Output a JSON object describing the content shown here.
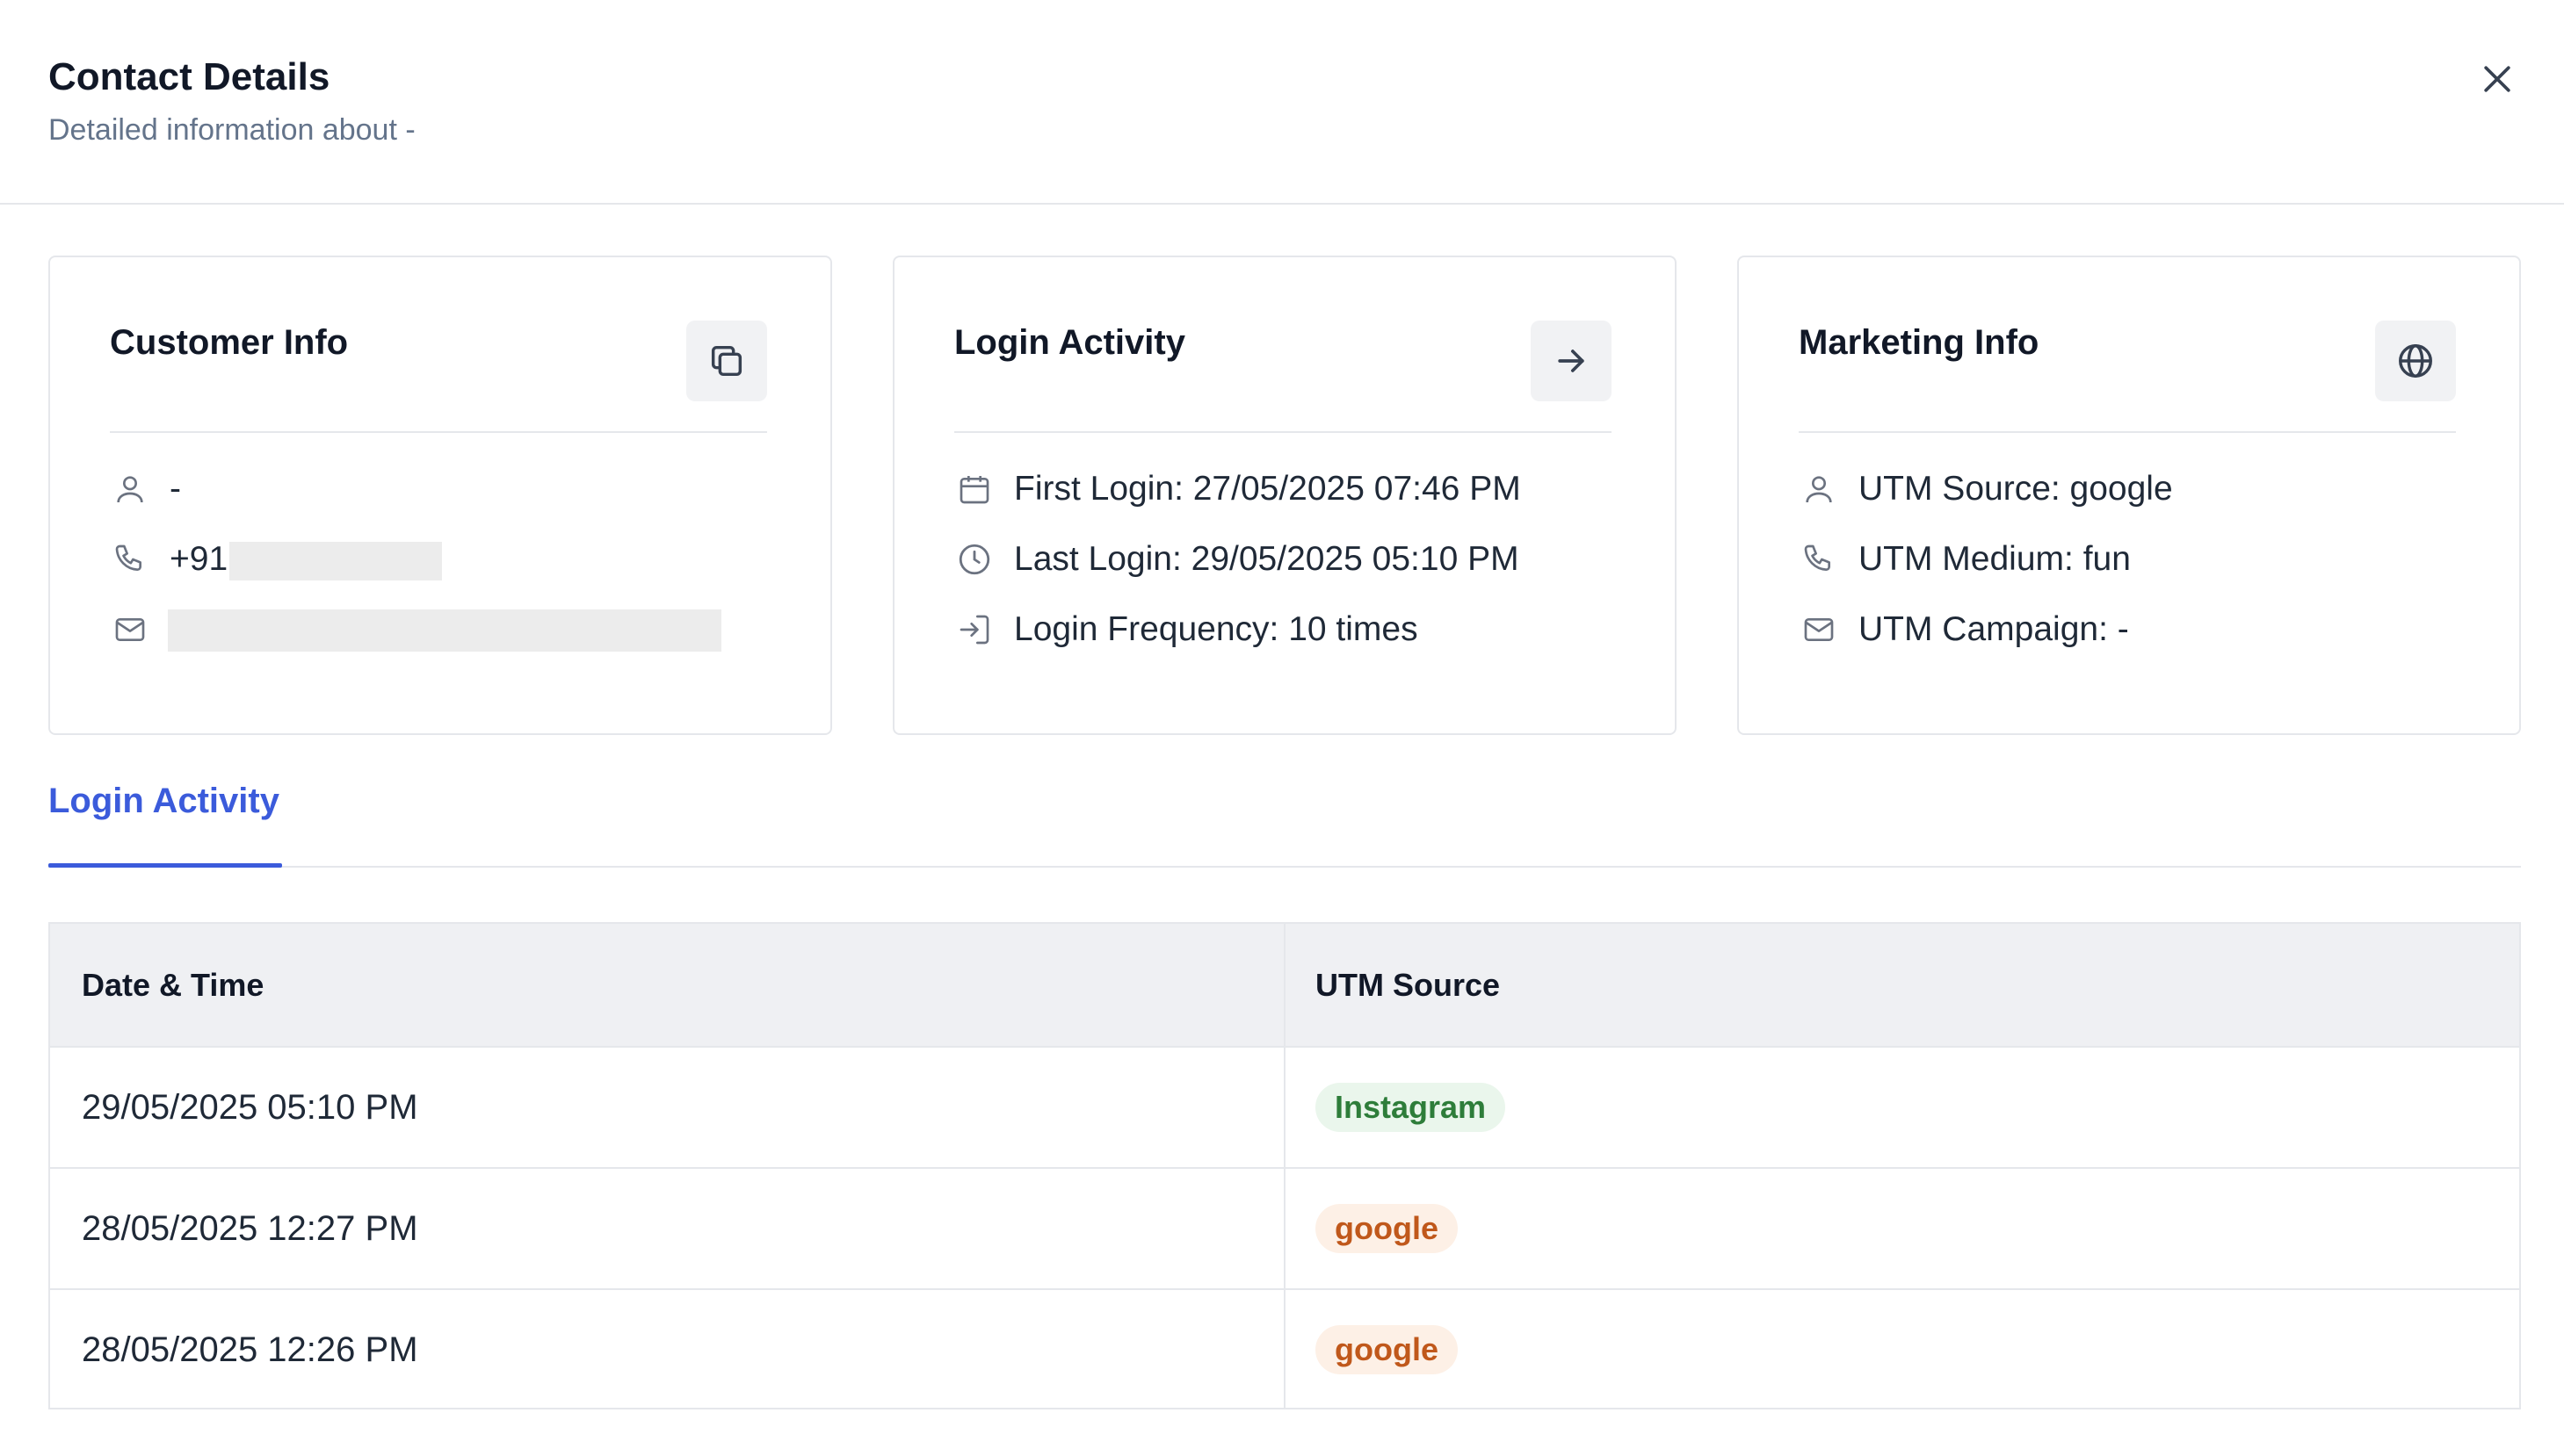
{
  "header": {
    "title": "Contact Details",
    "subtitle": "Detailed information about -"
  },
  "cards": {
    "customer": {
      "title": "Customer Info",
      "name": "-",
      "phone_prefix": "+91",
      "action_icon": "copy-icon"
    },
    "login": {
      "title": "Login Activity",
      "first_login": "First Login: 27/05/2025 07:46 PM",
      "last_login": "Last Login: 29/05/2025 05:10 PM",
      "frequency": "Login Frequency: 10 times",
      "action_icon": "arrow-right-icon"
    },
    "marketing": {
      "title": "Marketing Info",
      "utm_source": "UTM Source: google",
      "utm_medium": "UTM Medium: fun",
      "utm_campaign": "UTM Campaign: -",
      "action_icon": "globe-icon"
    }
  },
  "tabs": [
    {
      "label": "Login Activity",
      "active": true
    }
  ],
  "table": {
    "headers": [
      "Date & Time",
      "UTM Source"
    ],
    "rows": [
      {
        "datetime": "29/05/2025 05:10 PM",
        "source": "Instagram",
        "badge_color": "#2e7d3a"
      },
      {
        "datetime": "28/05/2025 12:27 PM",
        "source": "google",
        "badge_color": "#c0581b"
      },
      {
        "datetime": "28/05/2025 12:26 PM",
        "source": "google",
        "badge_color": "#c0581b"
      }
    ]
  },
  "colors": {
    "accent": "#3b5bdb",
    "badge_green_bg": "#eaf6ec",
    "badge_orange_bg": "#fdf0e6"
  }
}
